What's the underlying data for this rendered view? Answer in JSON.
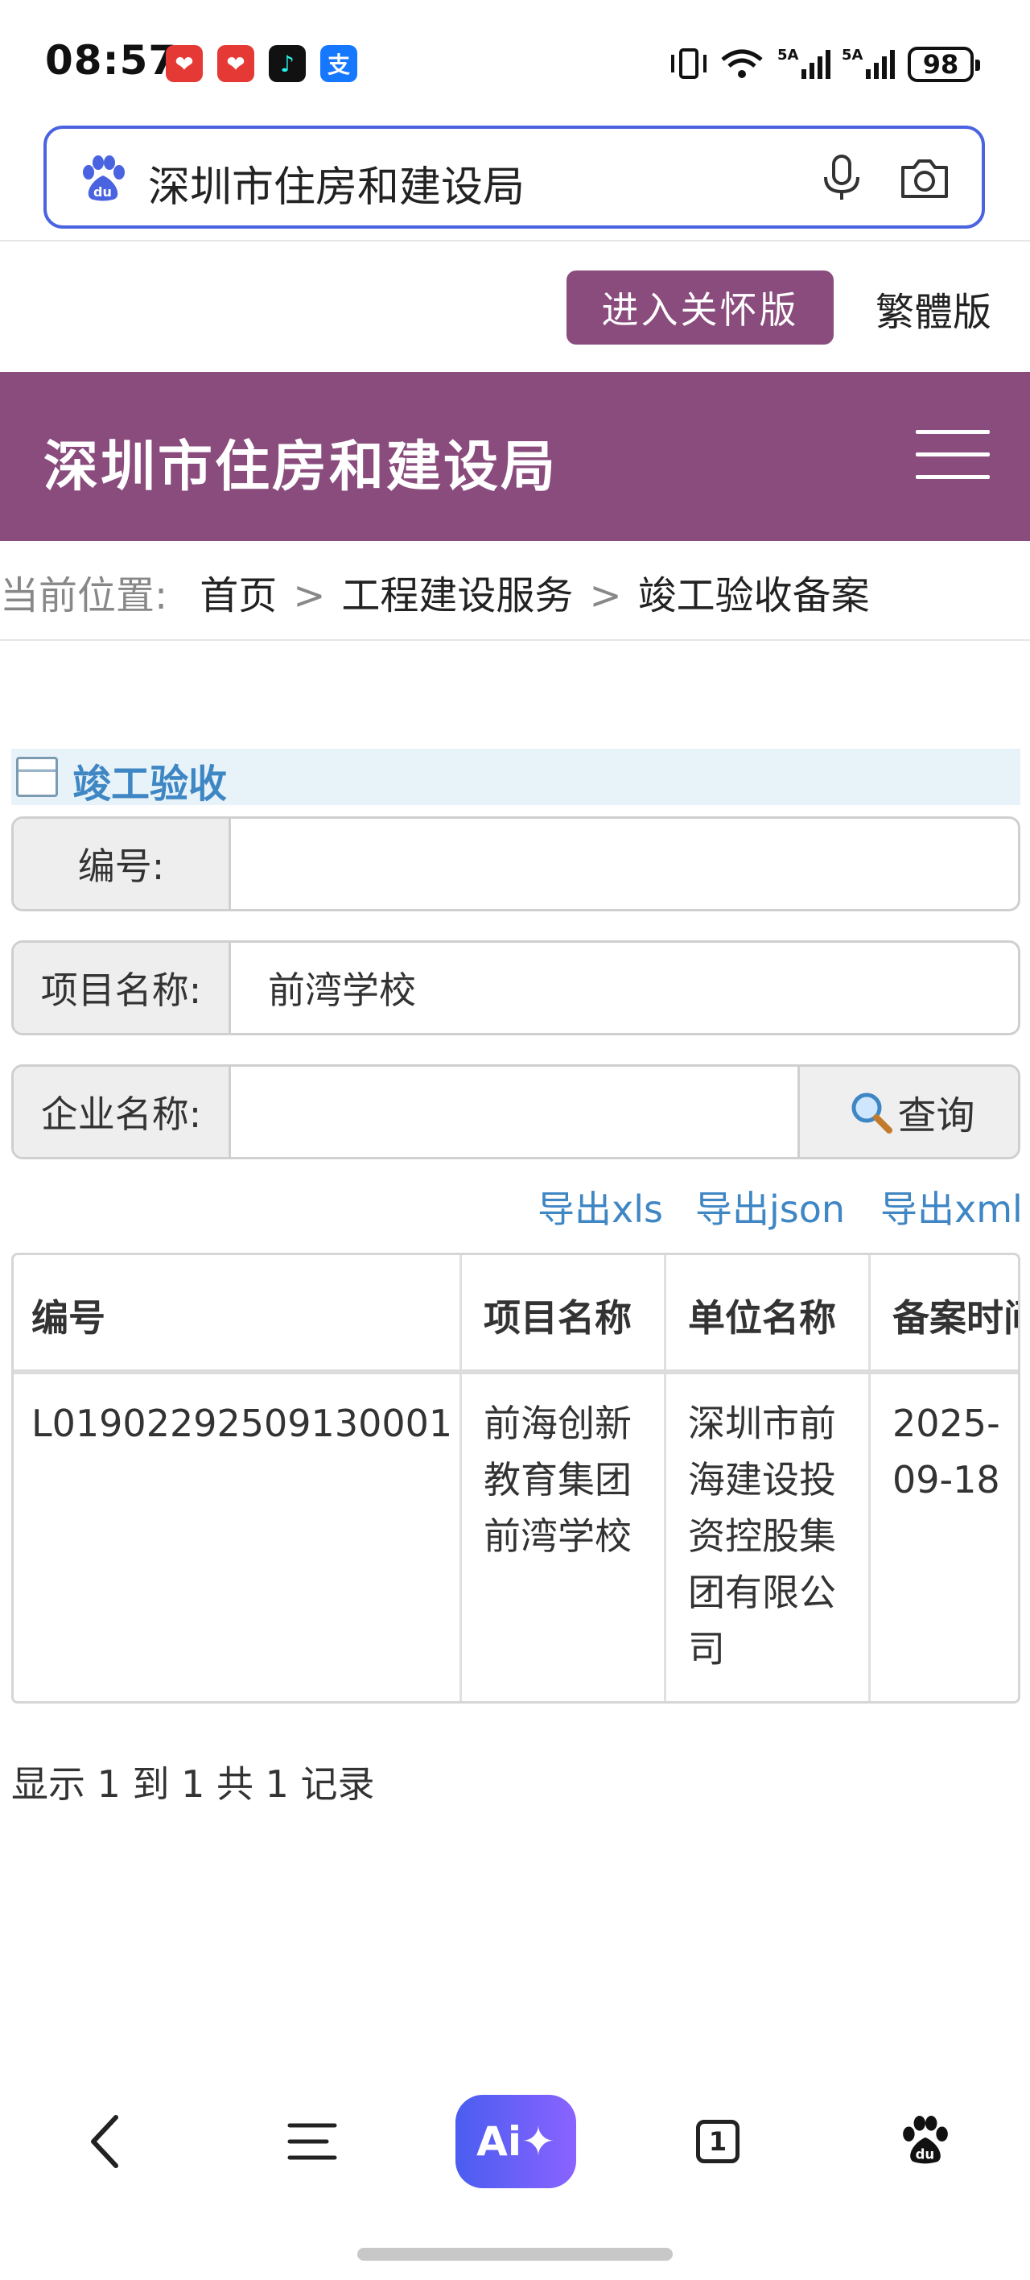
{
  "status_bar": {
    "time": "08:57",
    "battery": "98",
    "notification_icons": [
      "app-icon-1",
      "app-icon-2",
      "tiktok-icon",
      "alipay-icon"
    ],
    "alipay_glyph": "支"
  },
  "search": {
    "query": "深圳市住房和建设局"
  },
  "top_links": {
    "care_version": "进入关怀版",
    "traditional": "繁體版"
  },
  "header": {
    "title": "深圳市住房和建设局",
    "brand_color": "#8a4b7d"
  },
  "breadcrumb": {
    "label": "当前位置:",
    "items": [
      "首页",
      "工程建设服务",
      "竣工验收备案"
    ],
    "separator": ">"
  },
  "section": {
    "title": "竣工验收"
  },
  "form": {
    "number_label": "编号:",
    "number_value": "",
    "project_label": "项目名称:",
    "project_value": "前湾学校",
    "company_label": "企业名称:",
    "company_value": "",
    "query_button": "查询"
  },
  "exports": [
    "导出xls",
    "导出json",
    "导出xml"
  ],
  "table": {
    "headers": [
      "编号",
      "项目名称",
      "单位名称",
      "备案时间"
    ],
    "rows": [
      {
        "number": "L01902292509130001",
        "project": [
          "前海创新",
          "教育集团",
          "前湾学校"
        ],
        "unit": [
          "深圳市前",
          "海建设投",
          "资控股集",
          "团有限公",
          "司"
        ],
        "date": [
          "2025-",
          "09-18"
        ]
      }
    ]
  },
  "record_info": "显示 1 到 1 共 1 记录",
  "bottom_nav": {
    "ai_label": "Ai✦",
    "tabs_count": "1"
  }
}
